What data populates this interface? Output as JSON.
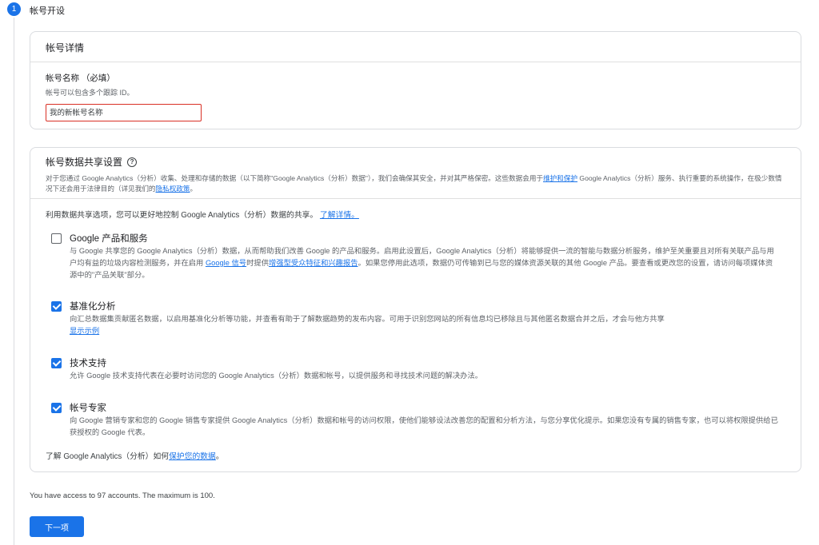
{
  "step": {
    "number": "1",
    "title": "帐号开设"
  },
  "account_details": {
    "header": "帐号详情",
    "name_label": "帐号名称 （必填）",
    "name_help": "帐号可以包含多个跟踪 ID。",
    "name_placeholder": "我的新帐号名称",
    "name_value": ""
  },
  "data_sharing": {
    "title": "帐号数据共享设置",
    "help_icon": "help-circle-icon",
    "description_part1": "对于您通过 Google Analytics（分析）收集、处理和存储的数据（以下简称\"Google Analytics（分析）数据\"），我们会确保其安全，并对其严格保密。这些数据会用于",
    "description_link1": "维护和保护",
    "description_part2": " Google Analytics（分析）服务、执行重要的系统操作，在极少数情况下还会用于法律目的（详见我们的",
    "description_link2": "隐私权政策",
    "description_part3": "。",
    "intro_text": "利用数据共享选项，您可以更好地控制 Google Analytics（分析）数据的共享。",
    "intro_link": "了解详情。",
    "options": [
      {
        "title": "Google 产品和服务",
        "checked": false,
        "desc_part1": "与 Google 共享您的 Google Analytics（分析）数据，从而帮助我们改善 Google 的产品和服务。启用此设置后，Google Analytics（分析）将能够提供一流的智能与数据分析服务，维护至关重要且对所有关联产品与用户均有益的垃圾内容检测服务，并在启用 ",
        "desc_link1": "Google 信号",
        "desc_part2": "时提供",
        "desc_link2": "增强型受众特征和兴趣报告",
        "desc_part3": "。如果您停用此选项，数据仍可传输到已与您的媒体资源关联的其他 Google 产品。要查看或更改您的设置，请访问每项媒体资源中的\"产品关联\"部分。"
      },
      {
        "title": "基准化分析",
        "checked": true,
        "desc": "向汇总数据集贡献匿名数据，以启用基准化分析等功能，并查看有助于了解数据趋势的发布内容。可用于识别您网站的所有信息均已移除且与其他匿名数据合并之后，才会与他方共享",
        "link": "显示示例"
      },
      {
        "title": "技术支持",
        "checked": true,
        "desc": "允许 Google 技术支持代表在必要时访问您的 Google Analytics（分析）数据和帐号，以提供服务和寻找技术问题的解决办法。"
      },
      {
        "title": "帐号专家",
        "checked": true,
        "desc": "向 Google 营销专家和您的 Google 销售专家提供 Google Analytics（分析）数据和帐号的访问权限，使他们能够设法改善您的配置和分析方法，与您分享优化提示。如果您没有专属的销售专家，也可以将权限提供给已获授权的 Google 代表。"
      }
    ],
    "footer_text": "了解 Google Analytics（分析）如何",
    "footer_link": "保护您的数据",
    "footer_end": "。"
  },
  "access_text": "You have access to 97 accounts. The maximum is 100.",
  "next_button": "下一项",
  "colors": {
    "accent": "#1a73e8",
    "error_border": "#d93025"
  }
}
